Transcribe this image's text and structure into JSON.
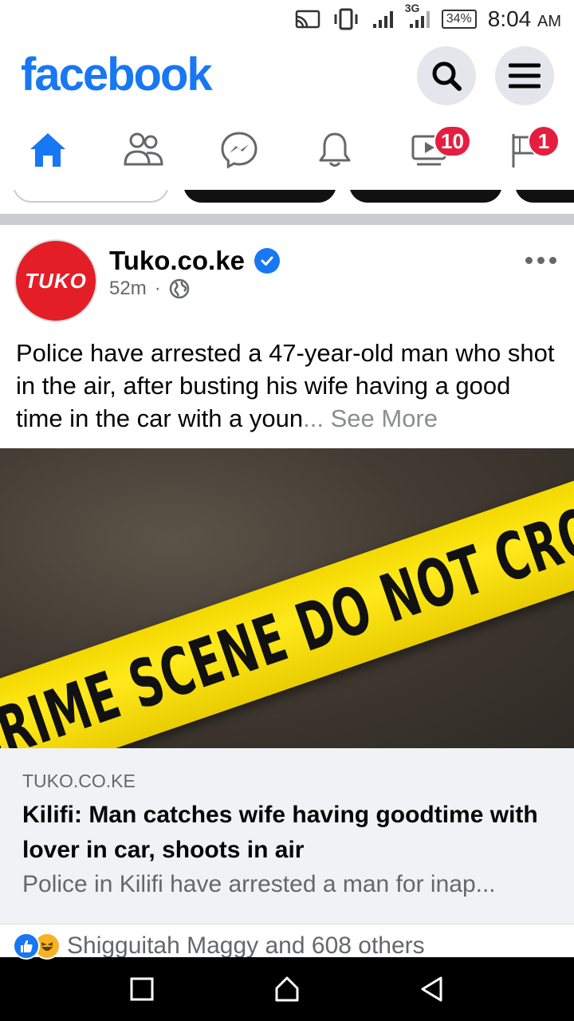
{
  "status_bar": {
    "network": "3G",
    "battery": "34%",
    "time": "8:04",
    "ampm": "AM",
    "icons": [
      "cast-icon",
      "vibrate-icon",
      "signal-icon",
      "signal-3g-icon",
      "battery-icon"
    ]
  },
  "header": {
    "logo": "facebook",
    "brand_color": "#1877f2",
    "buttons": [
      "search-icon",
      "menu-icon"
    ]
  },
  "nav": {
    "tabs": [
      {
        "name": "home",
        "icon": "home-icon",
        "active": true
      },
      {
        "name": "friends",
        "icon": "friends-icon"
      },
      {
        "name": "messenger",
        "icon": "messenger-icon"
      },
      {
        "name": "notifications",
        "icon": "bell-icon"
      },
      {
        "name": "watch",
        "icon": "video-icon",
        "badge": "10"
      },
      {
        "name": "marketplace",
        "icon": "flag-icon",
        "badge": "1"
      }
    ],
    "badge_color": "#e41e3f"
  },
  "post": {
    "author": "Tuko.co.ke",
    "avatar_text": "TUKO",
    "avatar_color": "#e41e26",
    "time": "52m",
    "privacy_icon": "globe-icon",
    "text": "Police have arrested a 47-year-old man who shot in the air, after busting his wife having a good time in the car with a youn",
    "ellipsis": "...",
    "see_more": "See More",
    "image_text": "CRIME SCENE DO NOT CROSS",
    "link": {
      "domain": "TUKO.CO.KE",
      "title": "Kilifi: Man catches wife having goodtime with lover in car, shoots in air",
      "description": "Police in Kilifi have arrested a man for inap..."
    },
    "reactions": {
      "icons": [
        "like-icon",
        "haha-icon"
      ],
      "text": "Shigguitah Maggy and 608 others"
    }
  },
  "android_nav": [
    "recents-icon",
    "home-icon",
    "back-icon"
  ]
}
